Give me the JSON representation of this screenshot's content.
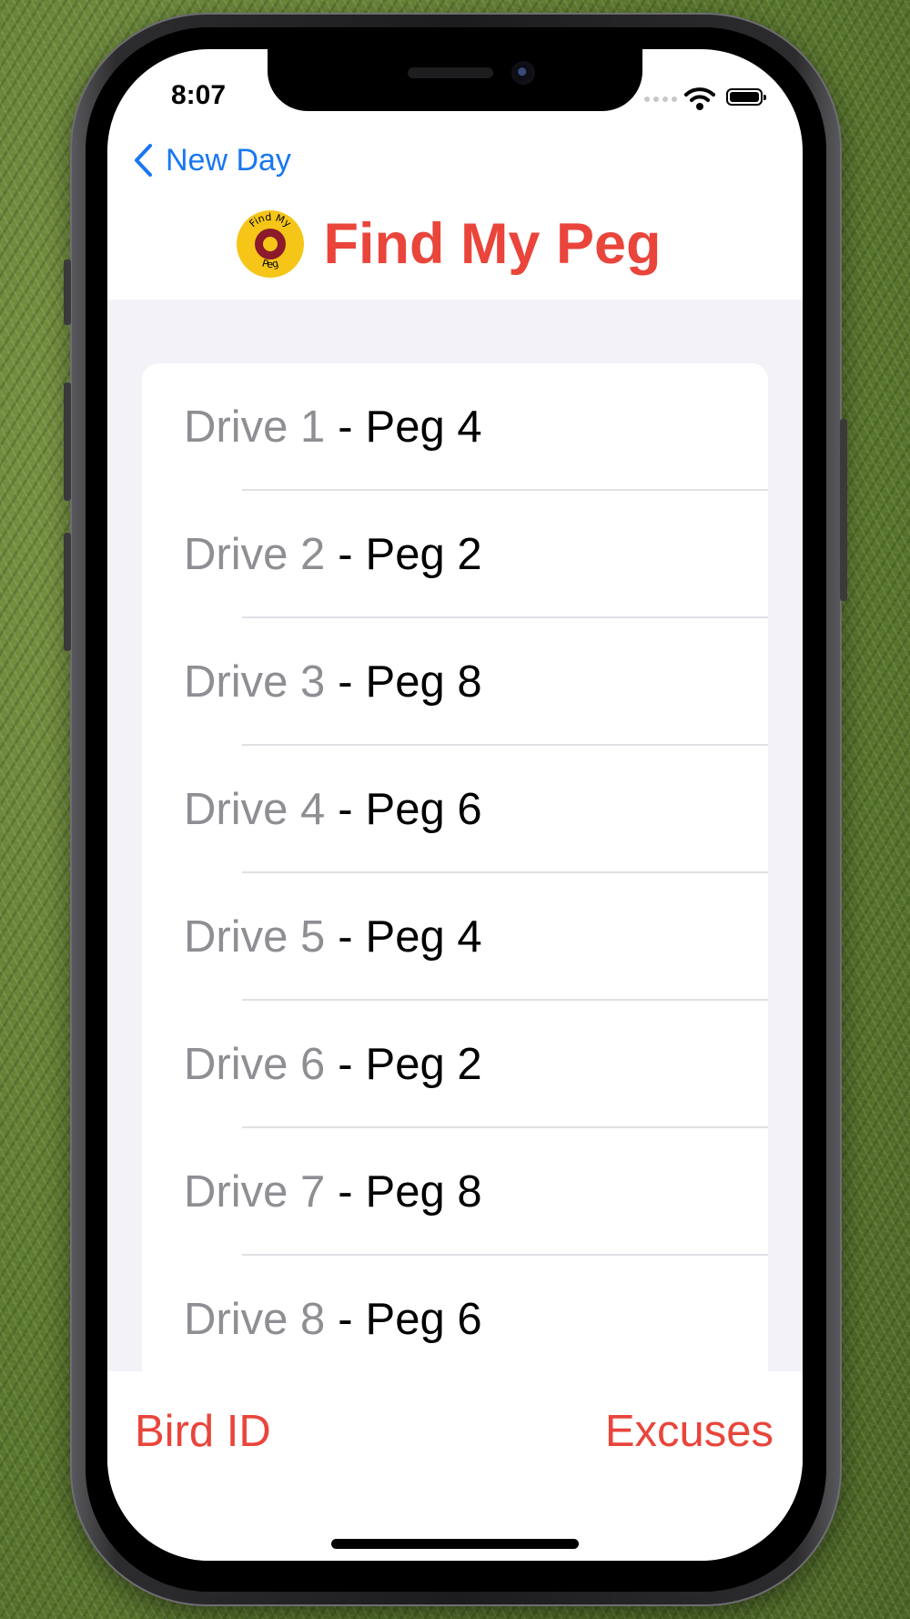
{
  "status_bar": {
    "time": "8:07"
  },
  "nav": {
    "back_label": "New Day"
  },
  "header": {
    "title": "Find My Peg",
    "logo_text_top": "Find My",
    "logo_text_bottom": "Peg"
  },
  "drives": [
    {
      "drive": "Drive 1",
      "sep": "-",
      "peg": "Peg 4"
    },
    {
      "drive": "Drive 2",
      "sep": "-",
      "peg": "Peg 2"
    },
    {
      "drive": "Drive 3",
      "sep": "-",
      "peg": "Peg 8"
    },
    {
      "drive": "Drive 4",
      "sep": "-",
      "peg": "Peg 6"
    },
    {
      "drive": "Drive 5",
      "sep": "-",
      "peg": "Peg 4"
    },
    {
      "drive": "Drive 6",
      "sep": "-",
      "peg": "Peg 2"
    },
    {
      "drive": "Drive 7",
      "sep": "-",
      "peg": "Peg 8"
    },
    {
      "drive": "Drive 8",
      "sep": "-",
      "peg": "Peg 6"
    }
  ],
  "tab_bar": {
    "left_label": "Bird ID",
    "right_label": "Excuses"
  },
  "colors": {
    "accent_red": "#e9453b",
    "link_blue": "#1877f2",
    "secondary_gray": "#8e8e93",
    "logo_yellow": "#f5c518",
    "logo_maroon": "#8b1a2b"
  },
  "icons": [
    "back-chevron-icon",
    "wifi-icon",
    "battery-icon",
    "signal-icon",
    "app-logo-icon"
  ]
}
